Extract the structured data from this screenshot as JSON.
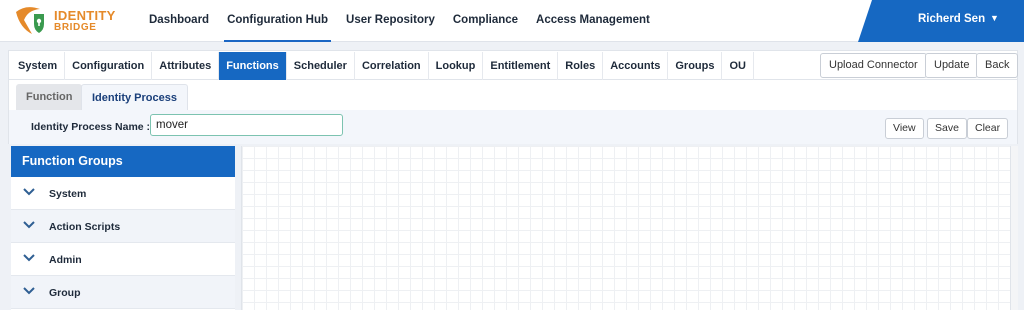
{
  "brand": {
    "line1": "IDENTITY",
    "line2": "BRIDGE",
    "accent": "#e58a2a"
  },
  "nav": {
    "items": [
      {
        "label": "Dashboard"
      },
      {
        "label": "Configuration Hub"
      },
      {
        "label": "User Repository"
      },
      {
        "label": "Compliance"
      },
      {
        "label": "Access Management"
      }
    ],
    "active": "Configuration Hub"
  },
  "user": {
    "name": "Richerd Sen",
    "icon": "caret-down-icon"
  },
  "tabs": {
    "items": [
      {
        "label": "System"
      },
      {
        "label": "Configuration"
      },
      {
        "label": "Attributes"
      },
      {
        "label": "Functions"
      },
      {
        "label": "Scheduler"
      },
      {
        "label": "Correlation"
      },
      {
        "label": "Lookup"
      },
      {
        "label": "Entitlement"
      },
      {
        "label": "Roles"
      },
      {
        "label": "Accounts"
      },
      {
        "label": "Groups"
      },
      {
        "label": "OU"
      }
    ],
    "active": "Functions",
    "actions": {
      "upload": "Upload Connector",
      "update": "Update",
      "back": "Back"
    }
  },
  "subtabs": {
    "function": "Function",
    "identity_process": "Identity Process",
    "active": "Identity Process"
  },
  "identity_process": {
    "label": "Identity Process Name :",
    "value": "mover",
    "view": "View",
    "save": "Save",
    "clear": "Clear"
  },
  "function_groups": {
    "title": "Function Groups",
    "items": [
      {
        "label": "System",
        "icon": "chevron-down-icon"
      },
      {
        "label": "Action Scripts",
        "icon": "chevron-down-icon"
      },
      {
        "label": "Admin",
        "icon": "chevron-down-icon"
      },
      {
        "label": "Group",
        "icon": "chevron-down-icon"
      }
    ]
  },
  "colors": {
    "primary": "#1668c2",
    "accent": "#e58a2a",
    "chevron": "#2f5f93"
  }
}
